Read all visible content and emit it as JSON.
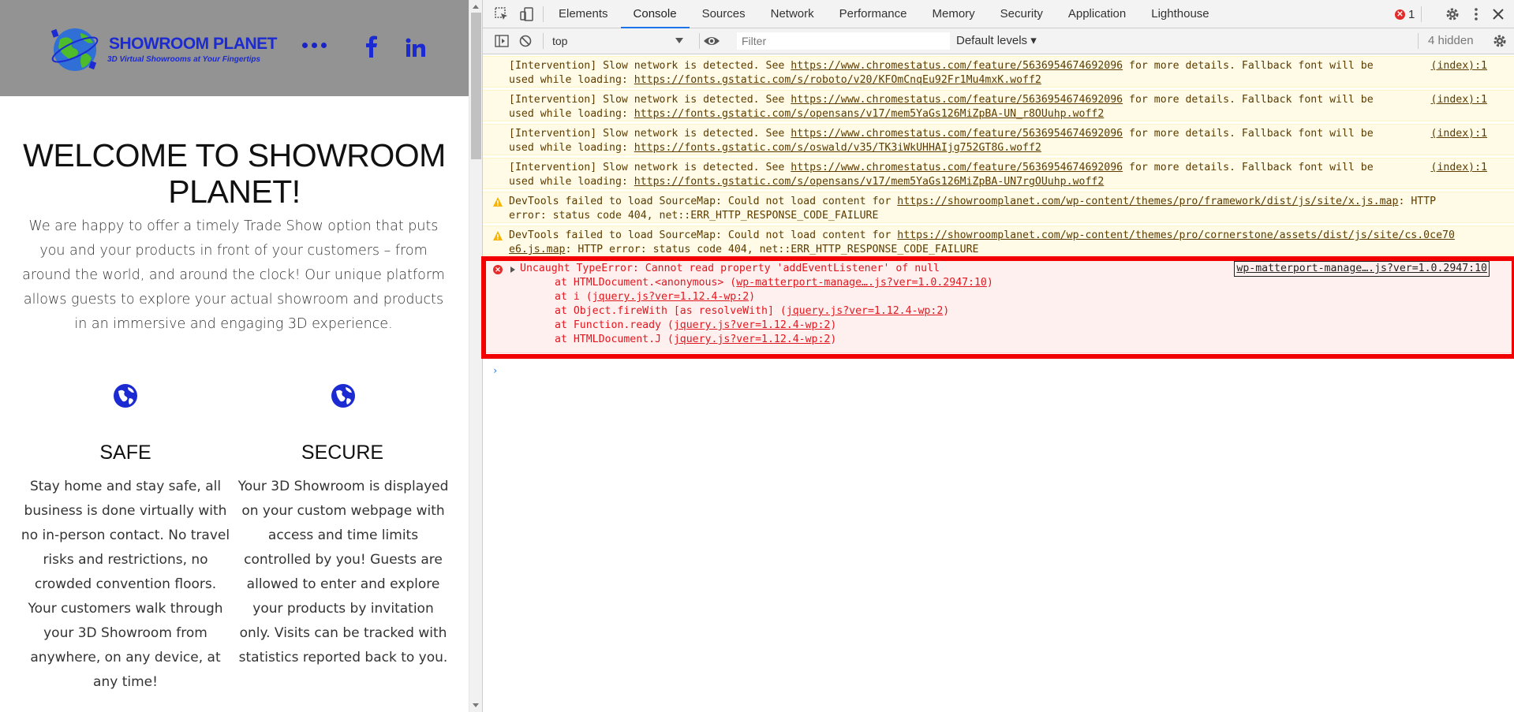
{
  "site": {
    "logo": {
      "name": "SHOWROOM PLANET",
      "tagline": "3D Virtual Showrooms at Your Fingertips"
    },
    "social": [
      "facebook-icon",
      "linkedin-icon"
    ],
    "hero": {
      "title": "WELCOME TO SHOWROOM PLANET!",
      "text": "We are happy to offer a timely Trade Show option that puts you and your products in front of your customers – from around the world, and around the clock! Our unique platform allows guests to explore your actual showroom and products in an immersive and engaging 3D experience."
    },
    "features": [
      {
        "title": "SAFE",
        "text": "Stay home and stay safe, all business is done virtually with no in-person contact. No travel risks and restrictions, no crowded convention floors. Your customers walk through your 3D Showroom from anywhere, on any device, at any time!"
      },
      {
        "title": "SECURE",
        "text": "Your 3D Showroom is displayed on your custom webpage with access and time limits controlled by you! Guests are allowed to enter and explore your products by invitation only. Visits can be tracked with statistics reported back to you."
      }
    ],
    "colors": {
      "header_bg": "#939393",
      "brand_blue": "#1c2bd1"
    }
  },
  "devtools": {
    "tabs": [
      "Elements",
      "Console",
      "Sources",
      "Network",
      "Performance",
      "Memory",
      "Security",
      "Application",
      "Lighthouse"
    ],
    "active_tab": "Console",
    "error_count": "1",
    "toolbar": {
      "context": "top",
      "filter_placeholder": "Filter",
      "levels": "Default levels ▾",
      "hidden": "4 hidden"
    },
    "messages": [
      {
        "type": "intervention",
        "prefix": "[Intervention] Slow network is detected. See ",
        "link1": "https://www.chromestatus.com/feature/5636954674692096",
        "mid": " for more details. Fallback font will be",
        "line2_prefix": "used while loading: ",
        "link2": "https://fonts.gstatic.com/s/roboto/v20/KFOmCnqEu92Fr1Mu4mxK.woff2",
        "source": "(index):1"
      },
      {
        "type": "intervention",
        "prefix": "[Intervention] Slow network is detected. See ",
        "link1": "https://www.chromestatus.com/feature/5636954674692096",
        "mid": " for more details. Fallback font will be",
        "line2_prefix": "used while loading: ",
        "link2": "https://fonts.gstatic.com/s/opensans/v17/mem5YaGs126MiZpBA-UN_r8OUuhp.woff2",
        "source": "(index):1"
      },
      {
        "type": "intervention",
        "prefix": "[Intervention] Slow network is detected. See ",
        "link1": "https://www.chromestatus.com/feature/5636954674692096",
        "mid": " for more details. Fallback font will be",
        "line2_prefix": "used while loading: ",
        "link2": "https://fonts.gstatic.com/s/oswald/v35/TK3iWkUHHAIjg752GT8G.woff2",
        "source": "(index):1"
      },
      {
        "type": "intervention",
        "prefix": "[Intervention] Slow network is detected. See ",
        "link1": "https://www.chromestatus.com/feature/5636954674692096",
        "mid": " for more details. Fallback font will be",
        "line2_prefix": "used while loading: ",
        "link2": "https://fonts.gstatic.com/s/opensans/v17/mem5YaGs126MiZpBA-UN7rgOUuhp.woff2",
        "source": "(index):1"
      },
      {
        "type": "warning",
        "prefix": "DevTools failed to load SourceMap: Could not load content for ",
        "link1": "https://showroomplanet.com/wp-content/themes/pro/framework/dist/js/site/x.js.map",
        "mid": ": HTTP",
        "line2_prefix": "error: status code 404, net::ERR_HTTP_RESPONSE_CODE_FAILURE",
        "link2": "",
        "source": ""
      },
      {
        "type": "warning",
        "prefix": "DevTools failed to load SourceMap: Could not load content for ",
        "link1": "https://showroomplanet.com/wp-content/themes/pro/cornerstone/assets/dist/js/site/cs.0ce70",
        "mid": "",
        "line2_prefix": "",
        "link2": "e6.js.map",
        "line2_suffix": ": HTTP error: status code 404, net::ERR_HTTP_RESPONSE_CODE_FAILURE",
        "source": ""
      }
    ],
    "error": {
      "text": "Uncaught TypeError: Cannot read property 'addEventListener' of null",
      "source": "wp-matterport-manage….js?ver=1.0.2947:10",
      "stack": [
        {
          "prefix": "at HTMLDocument.<anonymous> (",
          "link": "wp-matterport-manage….js?ver=1.0.2947:10",
          "suffix": ")"
        },
        {
          "prefix": "at i (",
          "link": "jquery.js?ver=1.12.4-wp:2",
          "suffix": ")"
        },
        {
          "prefix": "at Object.fireWith [as resolveWith] (",
          "link": "jquery.js?ver=1.12.4-wp:2",
          "suffix": ")"
        },
        {
          "prefix": "at Function.ready (",
          "link": "jquery.js?ver=1.12.4-wp:2",
          "suffix": ")"
        },
        {
          "prefix": "at HTMLDocument.J (",
          "link": "jquery.js?ver=1.12.4-wp:2",
          "suffix": ")"
        }
      ]
    },
    "colors": {
      "error_red": "#e0171e",
      "highlight_red": "#f20000",
      "warn_bg": "#fffbe6",
      "active_tab": "#1a73e8"
    }
  }
}
